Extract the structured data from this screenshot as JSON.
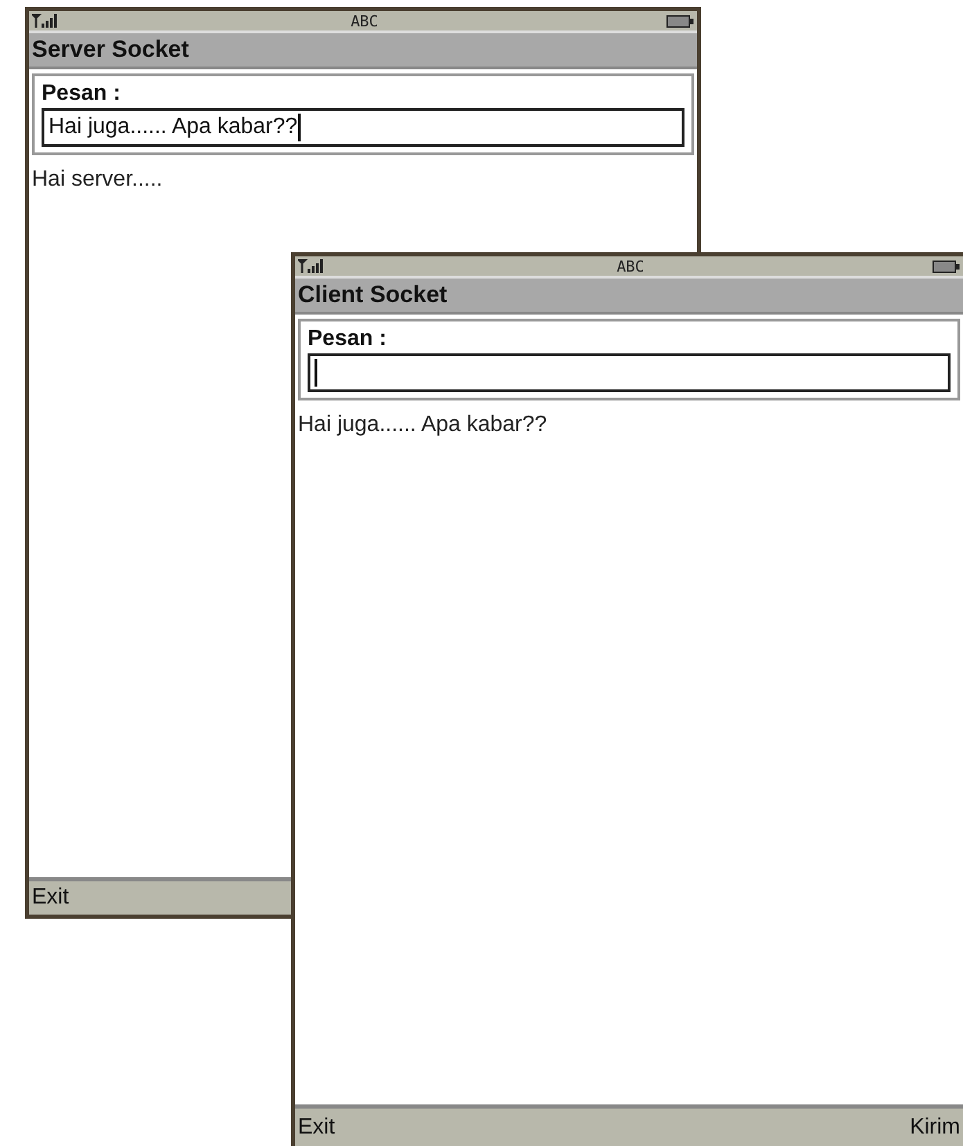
{
  "windows": [
    {
      "status": {
        "input_mode": "ABC"
      },
      "title": "Server Socket",
      "field": {
        "label": "Pesan :",
        "value": "Hai juga...... Apa kabar??"
      },
      "messages": [
        "Hai server....."
      ],
      "softkeys": {
        "left": "Exit"
      }
    },
    {
      "status": {
        "input_mode": "ABC"
      },
      "title": "Client Socket",
      "field": {
        "label": "Pesan :"
      },
      "messages": [
        "Hai juga...... Apa kabar??"
      ],
      "softkeys": {
        "left": "Exit",
        "right": "Kirim"
      }
    }
  ]
}
